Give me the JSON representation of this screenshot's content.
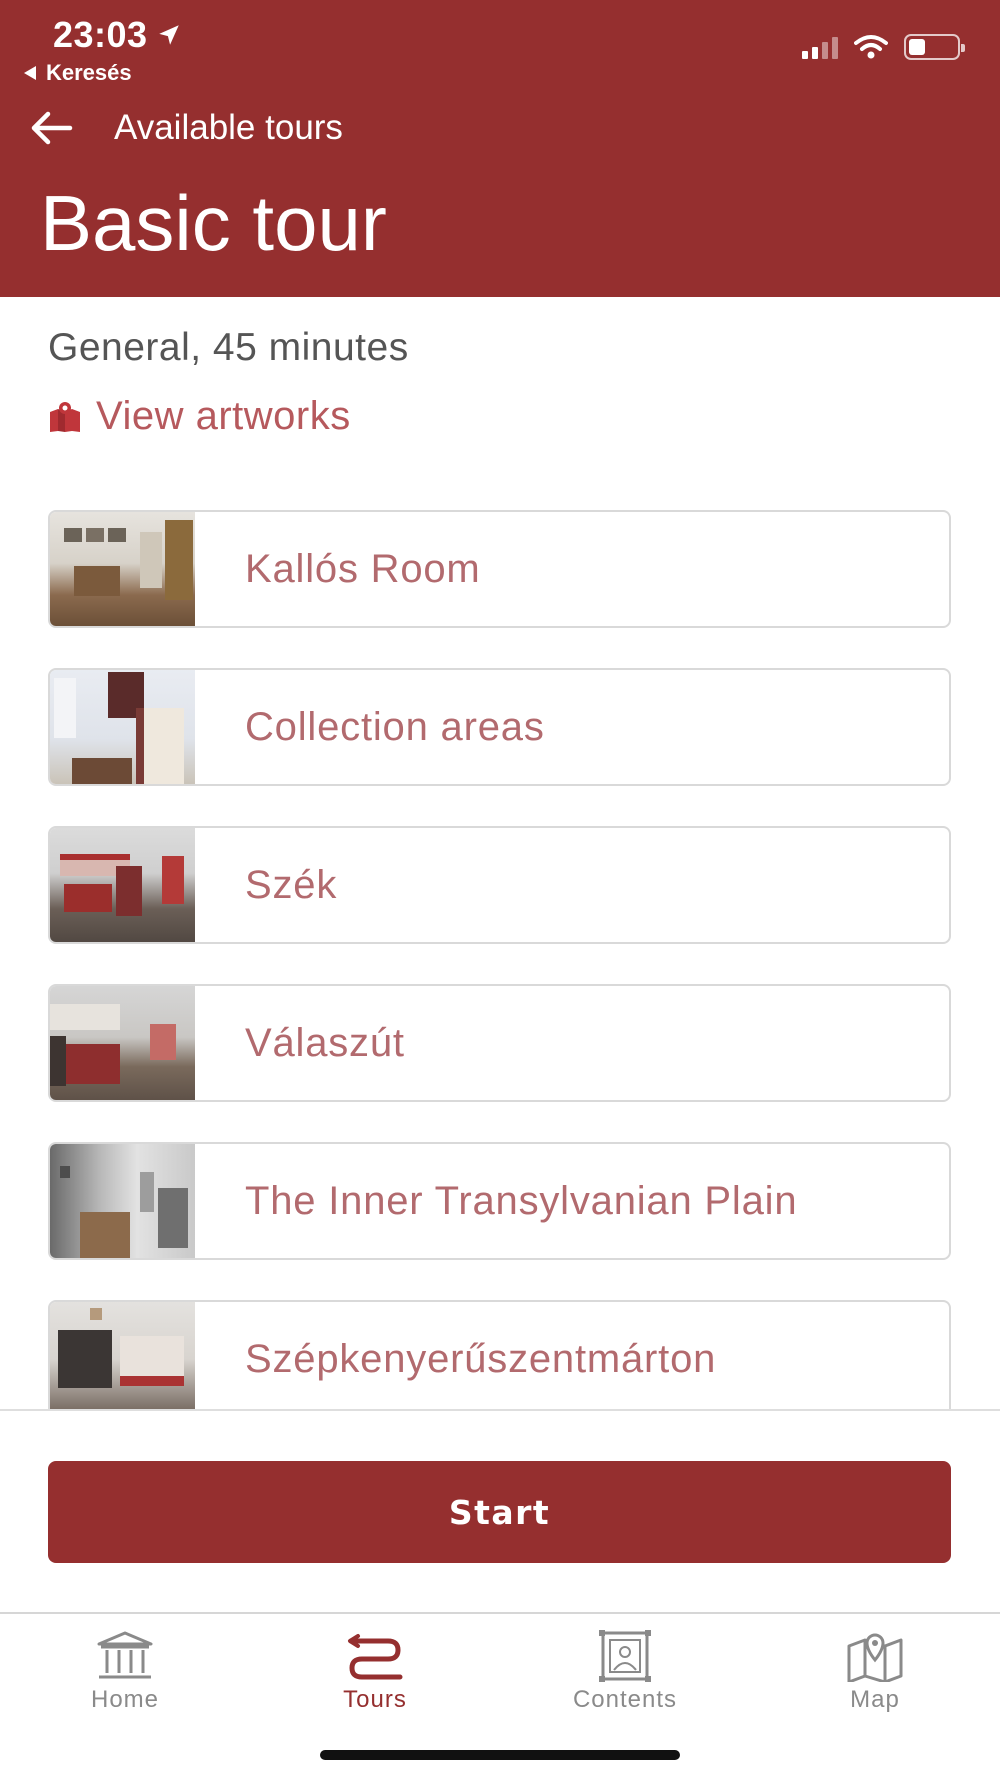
{
  "status_bar": {
    "time": "23:03",
    "back_app": "Keresés"
  },
  "header": {
    "back_label": "Available tours",
    "title": "Basic tour"
  },
  "tour": {
    "subtitle": "General, 45 minutes",
    "view_artworks": "View artworks"
  },
  "stops": [
    {
      "label": "Kallós Room"
    },
    {
      "label": "Collection areas"
    },
    {
      "label": "Szék"
    },
    {
      "label": "Válaszút"
    },
    {
      "label": "The Inner Transylvanian Plain"
    },
    {
      "label": "Szépkenyerűszentmárton"
    }
  ],
  "start_label": "Start",
  "tabs": [
    {
      "label": "Home",
      "icon": "museum-icon"
    },
    {
      "label": "Tours",
      "icon": "route-icon"
    },
    {
      "label": "Contents",
      "icon": "picture-frame-icon"
    },
    {
      "label": "Map",
      "icon": "map-icon"
    }
  ],
  "colors": {
    "brand": "#952f2f",
    "accent_text": "#b26a6e",
    "inactive_tab": "#8a8a8a"
  }
}
